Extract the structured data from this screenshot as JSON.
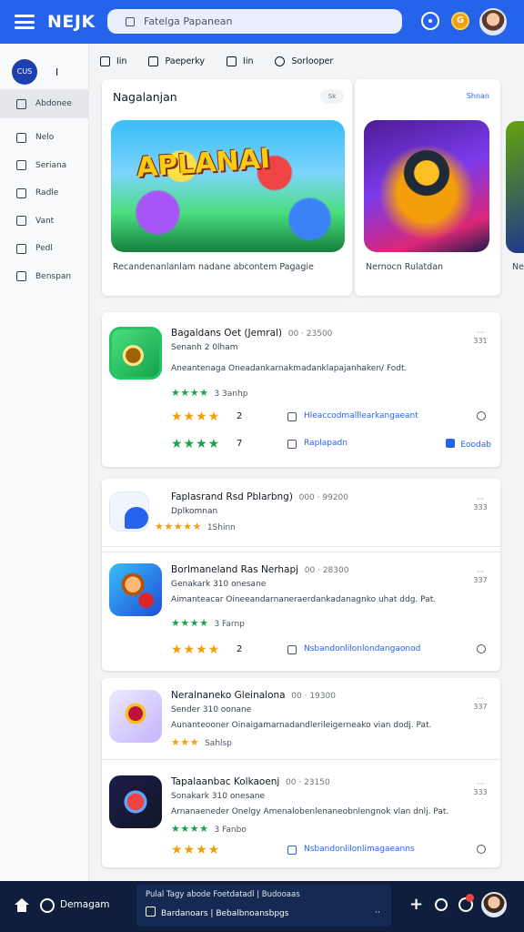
{
  "topbar": {
    "brand": "NEJK",
    "search_placeholder": "Fatelga Papanean",
    "coin_label": "G"
  },
  "sidebar": {
    "user_initials": "CUS",
    "user_name": "I",
    "items": [
      {
        "label": "Abdonee",
        "icon": "store-icon"
      },
      {
        "label": "Nelo",
        "icon": "cloud-icon"
      },
      {
        "label": "Seriana",
        "icon": "square-icon"
      },
      {
        "label": "Radle",
        "icon": "chat-icon"
      },
      {
        "label": "Vant",
        "icon": "book-icon"
      },
      {
        "label": "Pedl",
        "icon": "settings-icon"
      },
      {
        "label": "Benspan",
        "icon": "folder-icon"
      }
    ]
  },
  "subnav": [
    {
      "label": "Iin",
      "icon": "home-icon"
    },
    {
      "label": "Paeperky",
      "icon": "grid-icon"
    },
    {
      "label": "Iin",
      "icon": "star-icon"
    },
    {
      "label": "Sorlooper",
      "icon": "search-icon"
    }
  ],
  "featured": {
    "title": "Nagalanjan",
    "pill": "Sk",
    "more": "Shnan",
    "main_art_word": "APLANAI",
    "main_caption": "Recandenanlanlam nadane abcontem Pagagie",
    "side_caption": "Nernocn Rulatdan",
    "peek_caption": "Ne"
  },
  "list": [
    {
      "title": "Bagaldans Oet (Jemral)",
      "count": "00 · 23500",
      "meta": "Senanh 2 0lham",
      "desc": "Aneantenaga Oneadankarnakmadanklapajanhaken/ Fodt.",
      "rating_stars": "★★★★",
      "rating_count": "3 3anhp",
      "big_stars": "★★★★",
      "big_count": "2",
      "action1": "Hleaccodmalllearkangaeant",
      "action2": "Raplapadn",
      "pill": "Eoodab",
      "big_stars2": "★★★★",
      "big_count2": "7",
      "menu": "··· 331"
    },
    {
      "title": "Faplasrand Rsd Pblarbng)",
      "count": "000 · 99200",
      "meta": "Dplkomnan",
      "rating_stars": "★★★★★",
      "rating_count": "1Shinn",
      "menu": "··· 333"
    },
    {
      "title": "Borlmaneland Ras Nerhapj",
      "count": "00 · 28300",
      "meta": "Genakark 310 onesane",
      "desc": "Aimanteacar Oineeandarnaneraerdankadanagnko uhat ddg. Pat.",
      "rating_stars": "★★★★",
      "rating_count": "3 Farnp",
      "big_stars": "★★★★",
      "big_count": "2",
      "action1": "Nsbandonlilonlondangaonod",
      "menu": "··· 337"
    },
    {
      "title": "Neralnaneko Gleinalona",
      "count": "00 · 19300",
      "meta": "Sender 310 oonane",
      "desc": "Aunanteooner Oinaigamarnadandlerileigerneako vian dodj. Pat.",
      "rating_stars": "★★★",
      "rating_count": "Sahlsp",
      "menu": "··· 337"
    },
    {
      "title": "Tapalaanbac Kolkaoenj",
      "count": "00 · 23150",
      "meta": "Sonakark 310 onesane",
      "desc": "Arnanaeneder Onelgy Amenalobenlenaneobnlengnok vlan dnlj. Pat.",
      "rating_stars": "★★★★",
      "rating_count": "3 Fanbo",
      "big_stars": "★★★★",
      "big_count": "",
      "action1": "Nsbandonlilonlimagaeanns",
      "menu": "··· 333"
    }
  ],
  "bottombar": {
    "label": "Demagam",
    "line1": "Pulal Tagy abode Foetdatadl | Budooaas",
    "line2": "Bardanoars | Bebalbnoansbpgs",
    "expand": "··"
  },
  "colors": {
    "primary": "#2563eb",
    "bottom_bar": "#0f1e3d",
    "star_green": "#16a34a",
    "star_yellow": "#f59e0b"
  }
}
